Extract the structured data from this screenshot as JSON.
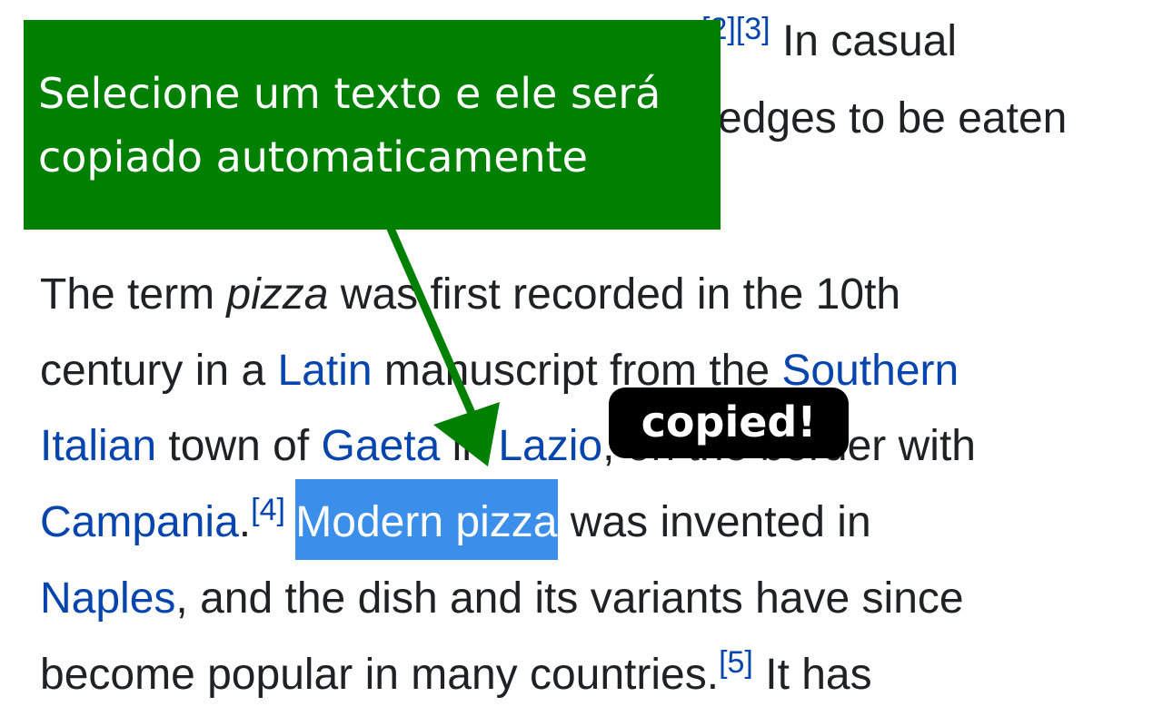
{
  "article": {
    "top_refs": [
      "[2]",
      "[3]"
    ],
    "top_text_a": " In casual",
    "top_text_b": "edges to be eaten",
    "l1": {
      "a": "The term ",
      "b": "pizza",
      "c": " was first recorded in the 10th"
    },
    "l2": {
      "a": "century in a ",
      "link_latin": "Latin",
      "b": " manuscript from the ",
      "link_southern": "Southern"
    },
    "l3": {
      "link_italian": "Italian",
      "a": " town of ",
      "link_gaeta": "Gaeta",
      "b": " in ",
      "link_lazio": "Lazio",
      "c": ", on the border with"
    },
    "l4": {
      "link_campania": "Campania",
      "a": ".",
      "ref4": "[4]",
      "selected": "Modern pizza",
      "b": " was invented in"
    },
    "l5": {
      "link_naples": "Naples",
      "a": ", and the dish and its variants have since"
    },
    "l6": {
      "a": "become popular in many countries.",
      "ref5": "[5]",
      "b": " It has"
    }
  },
  "callout": {
    "line1": "Selecione um texto e ele será",
    "line2": "copiado automaticamente"
  },
  "toast": {
    "text": "copied!"
  },
  "colors": {
    "link": "#0645ad",
    "selection": "#3b8eea",
    "callout_bg": "#008000",
    "toast_bg": "#000000"
  }
}
